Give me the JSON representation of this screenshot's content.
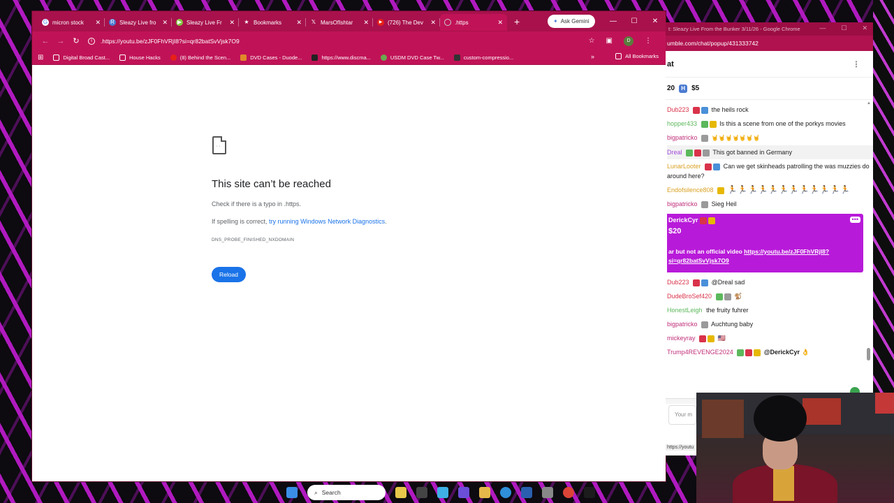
{
  "browser": {
    "tabs": [
      {
        "label": "micron stock",
        "color": "#ffffff"
      },
      {
        "label": "Sleazy Live fro",
        "color": "#4b7bd1"
      },
      {
        "label": "Sleazy Live Fr",
        "color": "#85c742"
      },
      {
        "label": "Bookmarks",
        "color": "#ffffff"
      },
      {
        "label": "MarsOfIshtar",
        "color": "#111111"
      },
      {
        "label": "(726) The Dev",
        "color": "#e62117"
      },
      {
        "label": ".https",
        "color": "#bbbbbb"
      }
    ],
    "gemini_label": "Ask Gemini",
    "address": ".https://youtu.be/zJF0FhVRjI8?si=qr82batSvVjsk7O9",
    "profile_initial": "D",
    "bookmarks": [
      "Digital Broad Cast...",
      "House Hacks",
      "(8) Behind the Scen...",
      "DVD Cases - Duode...",
      "https://www.discma...",
      "USDM DVD Case Tw...",
      "custom-compressio..."
    ],
    "bookmarks_more": "»",
    "all_bookmarks": "All Bookmarks"
  },
  "error_page": {
    "title": "This site can’t be reached",
    "line1": "Check if there is a typo in .https.",
    "line2_prefix": "If spelling is correct,",
    "line2_link": "try running Windows Network Diagnostics",
    "line2_suffix": ".",
    "code": "DNS_PROBE_FINISHED_NXDOMAIN",
    "reload_label": "Reload"
  },
  "chat": {
    "window_title": "t: Sleazy Live From the Bunker 3/11/26 - Google Chrome",
    "url": "umble.com/chat/popup/431333742",
    "header": "at",
    "rants_left": "20",
    "rants_right": "$5",
    "messages": [
      {
        "user": "Dub223",
        "user_color": "#d9334a",
        "text": "the heils rock"
      },
      {
        "user": "hopper433",
        "user_color": "#5cb85c",
        "text": "Is this a scene from one of the porkys movies"
      },
      {
        "user": "bigpatricko",
        "user_color": "#c0307a",
        "text": "🤘🤘🤘🤘🤘🤘🤘"
      },
      {
        "user": "Dreal",
        "user_color": "#a24ad9",
        "text": "This got banned in Germany"
      },
      {
        "user": "LunarLooter",
        "user_color": "#d9a020",
        "text": "Can we get skinheads patrolling the was muzzies do around here?"
      },
      {
        "user": "Endofsilence808",
        "user_color": "#d9a020",
        "text": "🏃🏃🏃🏃🏃🏃🏃🏃🏃🏃🏃🏃"
      },
      {
        "user": "bigpatricko",
        "user_color": "#c0307a",
        "text": "Sieg Heil"
      }
    ],
    "rant": {
      "user": "DerickCyr",
      "amount": "$20",
      "text": "ar but not an official video",
      "link": "https://youtu.be/zJF0FhVRjI8?si=qr82batSvVjsk7O9"
    },
    "messages2": [
      {
        "user": "Dub223",
        "user_color": "#d9334a",
        "text": "@Dreal sad"
      },
      {
        "user": "DudeBroSef420",
        "user_color": "#d9334a",
        "text": "🐒"
      },
      {
        "user": "HonestLeigh",
        "user_color": "#5cb85c",
        "text": "the fruity fuhrer"
      },
      {
        "user": "bigpatricko",
        "user_color": "#c0307a",
        "text": "Auchtung baby"
      },
      {
        "user": "mickeyray",
        "user_color": "#c0307a",
        "text": "🇺🇸"
      },
      {
        "user": "Trump4REVENGE2024",
        "user_color": "#c0307a",
        "text": "@DerickCyr 👌"
      }
    ],
    "input_placeholder": "Your m",
    "status_url": "https://youtu"
  },
  "taskbar": {
    "search_label": "Search"
  }
}
